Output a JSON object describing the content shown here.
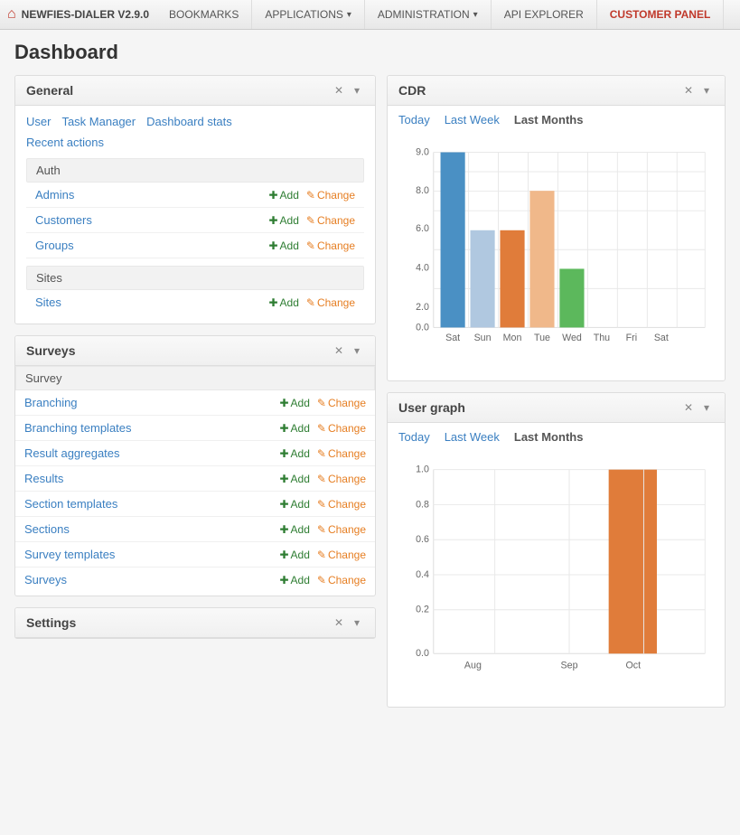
{
  "nav": {
    "brand": "NEWFIES-DIALER V2.9.0",
    "tabs": [
      {
        "label": "BOOKMARKS",
        "active": false,
        "hasArrow": false
      },
      {
        "label": "APPLICATIONS",
        "active": false,
        "hasArrow": true
      },
      {
        "label": "ADMINISTRATION",
        "active": false,
        "hasArrow": true
      },
      {
        "label": "API EXPLORER",
        "active": false,
        "hasArrow": false
      },
      {
        "label": "CUSTOMER PANEL",
        "active": false,
        "hasArrow": false,
        "highlight": true
      }
    ]
  },
  "page": {
    "title": "Dashboard"
  },
  "general_panel": {
    "title": "General",
    "links": [
      "User",
      "Task Manager",
      "Dashboard stats",
      "Recent actions"
    ],
    "sections": [
      {
        "name": "Auth",
        "items": [
          {
            "label": "Admins"
          },
          {
            "label": "Customers"
          },
          {
            "label": "Groups"
          }
        ]
      },
      {
        "name": "Sites",
        "items": [
          {
            "label": "Sites"
          }
        ]
      }
    ],
    "add_label": "Add",
    "change_label": "Change"
  },
  "surveys_panel": {
    "title": "Surveys",
    "sections": [
      {
        "name": "Survey",
        "items": [
          {
            "label": "Branching"
          },
          {
            "label": "Branching templates"
          },
          {
            "label": "Result aggregates"
          },
          {
            "label": "Results"
          },
          {
            "label": "Section templates"
          },
          {
            "label": "Sections"
          },
          {
            "label": "Survey templates"
          },
          {
            "label": "Surveys"
          }
        ]
      }
    ],
    "add_label": "Add",
    "change_label": "Change"
  },
  "settings_panel": {
    "title": "Settings"
  },
  "cdr_panel": {
    "title": "CDR",
    "tabs": [
      "Today",
      "Last Week",
      "Last Months"
    ],
    "active_tab": "Last Months",
    "chart": {
      "labels": [
        "Sat",
        "Sun",
        "Mon",
        "Tue",
        "Wed",
        "Thu",
        "Fri",
        "Sat"
      ],
      "bars": [
        {
          "value": 9.0,
          "color": "#4a90c4"
        },
        {
          "value": 5.0,
          "color": "#b0c8e0"
        },
        {
          "value": 5.0,
          "color": "#e07c3a"
        },
        {
          "value": 7.0,
          "color": "#f0b88a"
        },
        {
          "value": 3.0,
          "color": "#5cb85c"
        },
        {
          "value": 0,
          "color": "#4a90c4"
        },
        {
          "value": 0,
          "color": "#4a90c4"
        },
        {
          "value": 0,
          "color": "#4a90c4"
        }
      ],
      "ymax": 9.0,
      "yticks": [
        0,
        2,
        4,
        6,
        8,
        9
      ]
    }
  },
  "usergraph_panel": {
    "title": "User graph",
    "tabs": [
      "Today",
      "Last Week",
      "Last Months"
    ],
    "active_tab": "Last Months",
    "chart": {
      "labels": [
        "Aug",
        "Sep",
        "Oct"
      ],
      "bars": [
        {
          "value": 0,
          "color": "#e07c3a"
        },
        {
          "value": 0,
          "color": "#e07c3a"
        },
        {
          "value": 1.0,
          "color": "#e07c3a"
        }
      ],
      "ymax": 1.0,
      "yticks": [
        0,
        0.2,
        0.4,
        0.6,
        0.8,
        1.0
      ]
    }
  }
}
